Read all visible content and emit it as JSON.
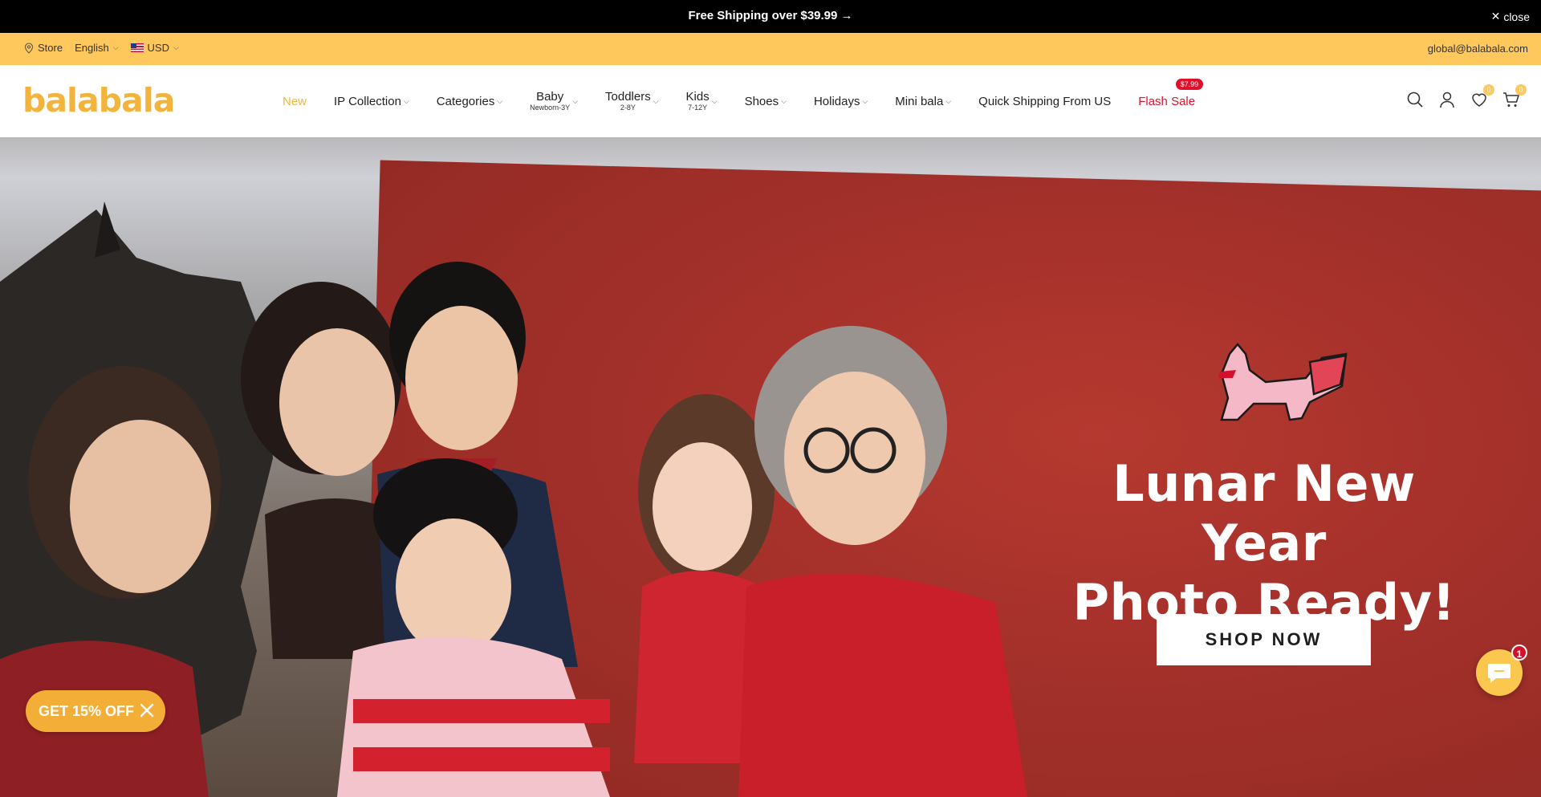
{
  "announcement": {
    "text": "Free Shipping over $39.99 →",
    "close_label": "close"
  },
  "utility": {
    "store_label": "Store",
    "language": "English",
    "currency": "USD",
    "email": "global@balabala.com"
  },
  "header": {
    "logo": "balabala",
    "nav": [
      {
        "label": "New",
        "sub": "",
        "dropdown": false
      },
      {
        "label": "IP Collection",
        "sub": "",
        "dropdown": true
      },
      {
        "label": "Categories",
        "sub": "",
        "dropdown": true
      },
      {
        "label": "Baby",
        "sub": "Newborn-3Y",
        "dropdown": true
      },
      {
        "label": "Toddlers",
        "sub": "2-8Y",
        "dropdown": true
      },
      {
        "label": "Kids",
        "sub": "7-12Y",
        "dropdown": true
      },
      {
        "label": "Shoes",
        "sub": "",
        "dropdown": true
      },
      {
        "label": "Holidays",
        "sub": "",
        "dropdown": true
      },
      {
        "label": "Mini bala",
        "sub": "",
        "dropdown": true
      },
      {
        "label": "Quick Shipping From US",
        "sub": "",
        "dropdown": false
      },
      {
        "label": "Flash Sale",
        "sub": "",
        "dropdown": false,
        "badge": "$7.99"
      }
    ],
    "wishlist_count": "0",
    "cart_count": "0"
  },
  "hero": {
    "title_line1": "Lunar New Year",
    "title_line2": "Photo Ready!",
    "cta": "SHOP NOW"
  },
  "promo": {
    "label": "GET 15% OFF"
  },
  "chat": {
    "badge": "1"
  },
  "colors": {
    "brand": "#f3b43e",
    "utility_bg": "#ffc85c",
    "sale": "#e0102a",
    "hero_wall": "#a3302a"
  }
}
